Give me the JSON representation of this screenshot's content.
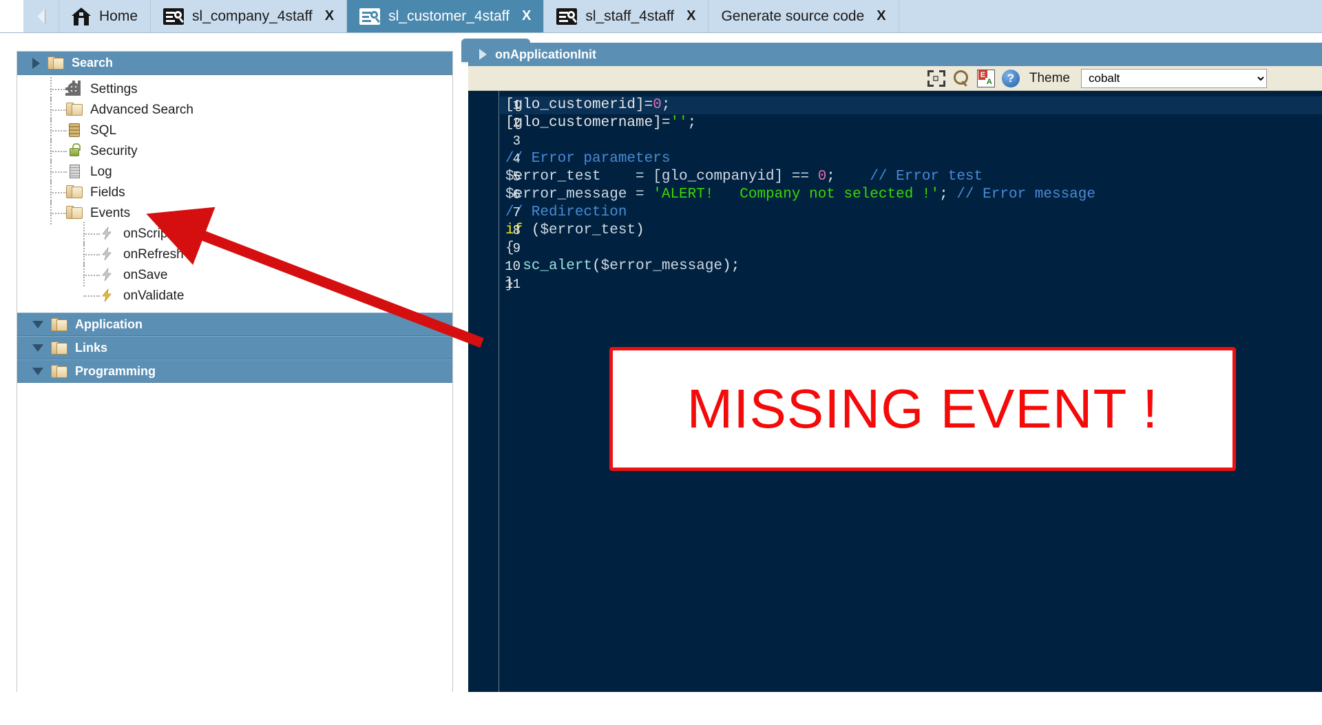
{
  "tabbar": {
    "nav_back_icon": "triangle-left-icon",
    "tabs": [
      {
        "label": "Home",
        "icon": "home-icon",
        "closable": false,
        "active": false
      },
      {
        "label": "sl_company_4staff",
        "icon": "scriptcase-app-icon",
        "close_label": "X",
        "active": false
      },
      {
        "label": "sl_customer_4staff",
        "icon": "scriptcase-app-icon",
        "close_label": "X",
        "active": true
      },
      {
        "label": "sl_staff_4staff",
        "icon": "scriptcase-app-icon",
        "close_label": "X",
        "active": false
      },
      {
        "label": "Generate source code",
        "icon": "none",
        "close_label": "X",
        "active": false
      }
    ]
  },
  "sidebar": {
    "groups": [
      {
        "label": "Search",
        "state": "collapsed-marker",
        "icon": "folder-icon"
      },
      {
        "label": "Application",
        "state": "expanded-marker",
        "icon": "folder-icon"
      },
      {
        "label": "Links",
        "state": "expanded-marker",
        "icon": "folder-icon"
      },
      {
        "label": "Programming",
        "state": "expanded-marker",
        "icon": "folder-icon"
      }
    ],
    "items": [
      {
        "label": "Settings",
        "icon": "gear-icon",
        "level": 1
      },
      {
        "label": "Advanced Search",
        "icon": "folder-icon",
        "level": 1
      },
      {
        "label": "SQL",
        "icon": "sql-icon",
        "level": 1
      },
      {
        "label": "Security",
        "icon": "lock-icon",
        "level": 1
      },
      {
        "label": "Log",
        "icon": "log-icon",
        "level": 1
      },
      {
        "label": "Fields",
        "icon": "folder-icon",
        "level": 1
      },
      {
        "label": "Events",
        "icon": "folder-icon",
        "level": 1
      }
    ],
    "events": [
      {
        "label": "onScriptInit",
        "icon": "bolt-icon-grey"
      },
      {
        "label": "onRefresh",
        "icon": "bolt-icon-grey"
      },
      {
        "label": "onSave",
        "icon": "bolt-icon-grey"
      },
      {
        "label": "onValidate",
        "icon": "bolt-icon-gold"
      }
    ]
  },
  "editor": {
    "title": "onApplicationInit",
    "expand_icon": "triangle-right-icon",
    "toolbar": {
      "maximize_icon": "maximize-icon",
      "search_icon": "search-icon",
      "translate_icon": "translate-icon",
      "help_icon": "help-icon",
      "theme_label": "Theme",
      "theme_value": "cobalt",
      "theme_options": [
        "cobalt"
      ]
    },
    "code_lines": [
      {
        "n": "1",
        "current": true,
        "tokens": [
          {
            "t": "[glo_customerid]=",
            "c": "k-plain"
          },
          {
            "t": "0",
            "c": "k-num"
          },
          {
            "t": ";",
            "c": "k-plain"
          }
        ]
      },
      {
        "n": "2",
        "current": false,
        "tokens": [
          {
            "t": "[glo_customername]=",
            "c": "k-plain"
          },
          {
            "t": "''",
            "c": "k-str"
          },
          {
            "t": ";",
            "c": "k-plain"
          }
        ]
      },
      {
        "n": "3",
        "current": false,
        "tokens": []
      },
      {
        "n": "4",
        "current": false,
        "tokens": [
          {
            "t": "// Error parameters",
            "c": "k-com"
          }
        ]
      },
      {
        "n": "5",
        "current": false,
        "tokens": [
          {
            "t": "$error_test    = [glo_companyid] == ",
            "c": "k-var"
          },
          {
            "t": "0",
            "c": "k-num"
          },
          {
            "t": ";    ",
            "c": "k-plain"
          },
          {
            "t": "// Error test",
            "c": "k-com"
          }
        ]
      },
      {
        "n": "6",
        "current": false,
        "tokens": [
          {
            "t": "$error_message = ",
            "c": "k-var"
          },
          {
            "t": "'ALERT!   Company not selected !'",
            "c": "k-str"
          },
          {
            "t": "; ",
            "c": "k-plain"
          },
          {
            "t": "// Error message",
            "c": "k-com"
          }
        ]
      },
      {
        "n": "7",
        "current": false,
        "tokens": [
          {
            "t": "// Redirection",
            "c": "k-com"
          }
        ]
      },
      {
        "n": "8",
        "current": false,
        "tokens": [
          {
            "t": "if",
            "c": "k-kw"
          },
          {
            "t": " (",
            "c": "k-plain"
          },
          {
            "t": "$error_test",
            "c": "k-var"
          },
          {
            "t": ")",
            "c": "k-plain"
          }
        ]
      },
      {
        "n": "9",
        "current": false,
        "tokens": [
          {
            "t": "{",
            "c": "k-brk"
          }
        ]
      },
      {
        "n": "10",
        "current": false,
        "tokens": [
          {
            "t": "  ",
            "c": "k-plain"
          },
          {
            "t": "sc_alert",
            "c": "k-fn"
          },
          {
            "t": "(",
            "c": "k-plain"
          },
          {
            "t": "$error_message",
            "c": "k-var"
          },
          {
            "t": ");",
            "c": "k-plain"
          }
        ]
      },
      {
        "n": "11",
        "current": false,
        "tokens": [
          {
            "t": "}",
            "c": "k-brk"
          }
        ]
      }
    ]
  },
  "annotation": {
    "text": "MISSING EVENT !",
    "color": "#f50a0a",
    "arrow": "red-arrow-pointing-to-events-node"
  }
}
